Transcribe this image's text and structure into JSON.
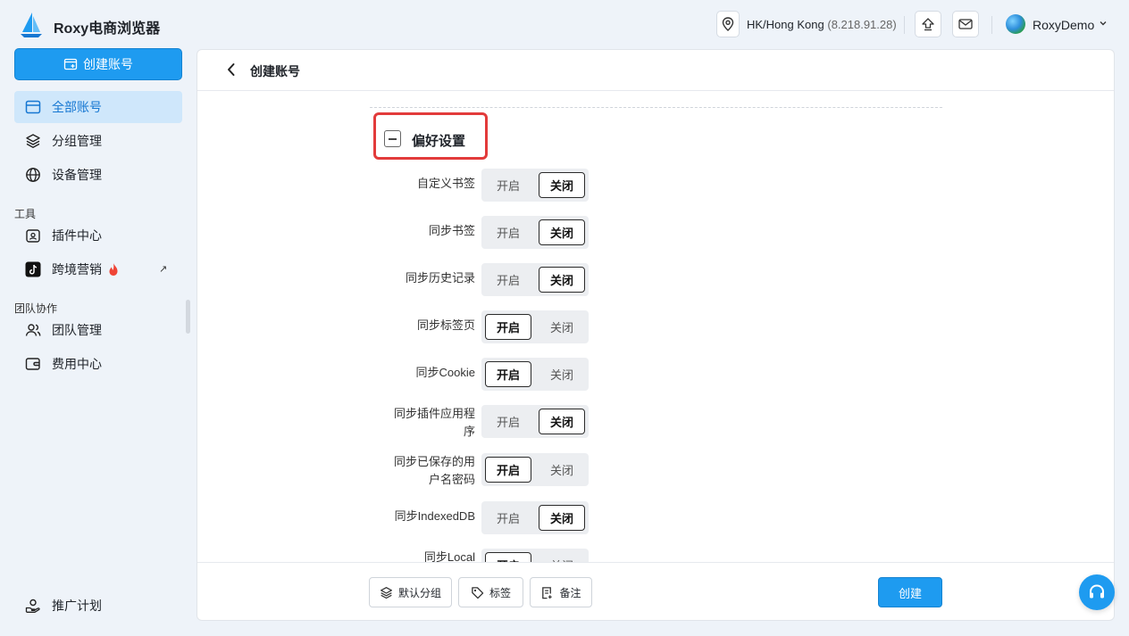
{
  "app": {
    "title": "Roxy电商浏览器"
  },
  "header": {
    "location": "HK/Hong Kong",
    "ip": "(8.218.91.28)",
    "user": "RoxyDemo"
  },
  "sidebar": {
    "create_label": "创建账号",
    "items": [
      {
        "label": "全部账号",
        "icon": "browser-window-icon",
        "active": true
      },
      {
        "label": "分组管理",
        "icon": "layers-icon"
      },
      {
        "label": "设备管理",
        "icon": "globe-icon"
      }
    ],
    "tools_section": "工具",
    "tools": [
      {
        "label": "插件中心",
        "icon": "plugin-icon"
      },
      {
        "label": "跨境营销",
        "icon": "tiktok-icon",
        "badge": "fire-icon",
        "external": "↗"
      }
    ],
    "team_section": "团队协作",
    "team": [
      {
        "label": "团队管理",
        "icon": "team-icon"
      },
      {
        "label": "费用中心",
        "icon": "wallet-icon"
      }
    ],
    "bottom": {
      "label": "推广计划",
      "icon": "promo-icon"
    }
  },
  "page": {
    "title": "创建账号",
    "section_title": "偏好设置",
    "on_label": "开启",
    "off_label": "关闭",
    "prefs": [
      {
        "label": "自定义书签",
        "value": "关闭"
      },
      {
        "label": "同步书签",
        "value": "关闭"
      },
      {
        "label": "同步历史记录",
        "value": "关闭"
      },
      {
        "label": "同步标签页",
        "value": "开启"
      },
      {
        "label": "同步Cookie",
        "value": "开启"
      },
      {
        "label": "同步插件应用程序",
        "value": "关闭"
      },
      {
        "label": "同步已保存的用户名密码",
        "value": "开启"
      },
      {
        "label": "同步IndexedDB",
        "value": "关闭"
      },
      {
        "label": "同步Local",
        "value": "开启"
      }
    ]
  },
  "footer": {
    "default_group": "默认分组",
    "tags": "标签",
    "notes": "备注",
    "submit": "创建"
  },
  "colors": {
    "accent": "#1e9bf0",
    "highlight_box": "#e23b3b",
    "active_nav_bg": "#cfe7fb"
  }
}
